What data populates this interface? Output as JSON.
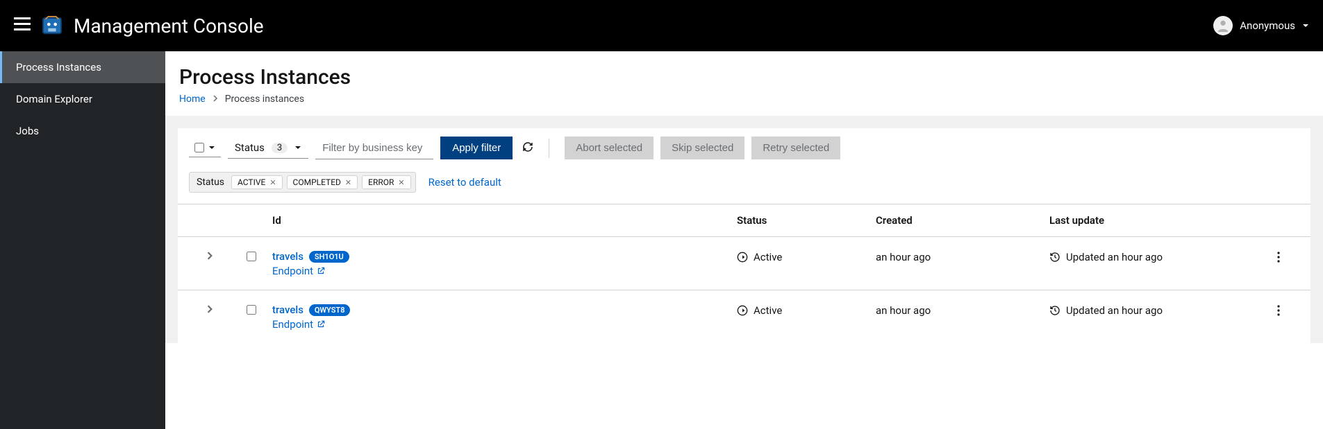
{
  "header": {
    "title": "Management Console",
    "username": "Anonymous"
  },
  "sidebar": {
    "items": [
      {
        "label": "Process Instances",
        "active": true
      },
      {
        "label": "Domain Explorer",
        "active": false
      },
      {
        "label": "Jobs",
        "active": false
      }
    ]
  },
  "page": {
    "title": "Process Instances"
  },
  "breadcrumb": {
    "home": "Home",
    "current": "Process instances"
  },
  "toolbar": {
    "status_label": "Status",
    "status_count": "3",
    "filter_placeholder": "Filter by business key",
    "apply_label": "Apply filter",
    "abort_label": "Abort selected",
    "skip_label": "Skip selected",
    "retry_label": "Retry selected"
  },
  "chips": {
    "group_label": "Status",
    "items": [
      "ACTIVE",
      "COMPLETED",
      "ERROR"
    ],
    "reset_label": "Reset to default"
  },
  "table": {
    "headers": {
      "id": "Id",
      "status": "Status",
      "created": "Created",
      "last_update": "Last update"
    },
    "rows": [
      {
        "name": "travels",
        "id_badge": "SH1O1U",
        "endpoint_label": "Endpoint",
        "status": "Active",
        "created": "an hour ago",
        "updated": "Updated an hour ago"
      },
      {
        "name": "travels",
        "id_badge": "QWYST8",
        "endpoint_label": "Endpoint",
        "status": "Active",
        "created": "an hour ago",
        "updated": "Updated an hour ago"
      }
    ]
  }
}
